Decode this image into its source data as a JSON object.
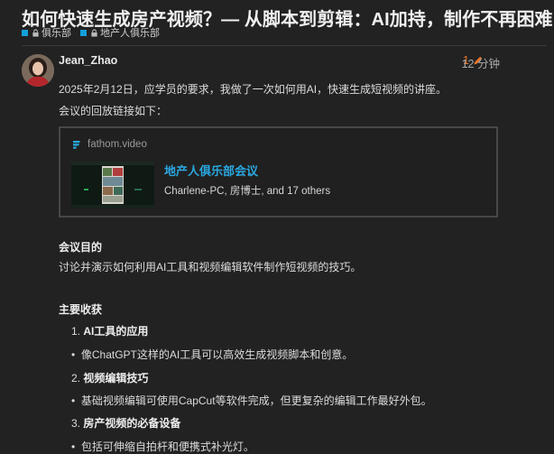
{
  "topic": {
    "title": "如何快速生成房产视频？— 从脚本到剪辑：AI加持，制作不再困难",
    "categories": [
      {
        "label": "俱乐部",
        "color": "#12a0d8"
      },
      {
        "label": "地产人俱乐部",
        "color": "#12a0d8"
      }
    ]
  },
  "post": {
    "username": "Jean_Zhao",
    "edit_count": "1",
    "time": "12 分钟",
    "intro": "2025年2月12日，应学员的要求，我做了一次如何用AI，快速生成短视频的讲座。",
    "replay_label": "会议的回放链接如下：",
    "onebox": {
      "source": "fathom.video",
      "title": "地产人俱乐部会议",
      "description": "Charlene-PC, 房博士, and 17 others"
    },
    "purpose_heading": "会议目的",
    "purpose_text": "讨论并演示如何利用AI工具和视频编辑软件制作短视频的技巧。",
    "gains_heading": "主要收获",
    "list": [
      {
        "num": "1.",
        "title": "AI工具的应用",
        "bullet": "像ChatGPT这样的AI工具可以高效生成视频脚本和创意。"
      },
      {
        "num": "2.",
        "title": "视频编辑技巧",
        "bullet": "基础视频编辑可使用CapCut等软件完成，但更复杂的编辑工作最好外包。"
      },
      {
        "num": "3.",
        "title": "房产视频的必备设备",
        "bullet": "包括可伸缩自拍杆和便携式补光灯。"
      }
    ]
  }
}
